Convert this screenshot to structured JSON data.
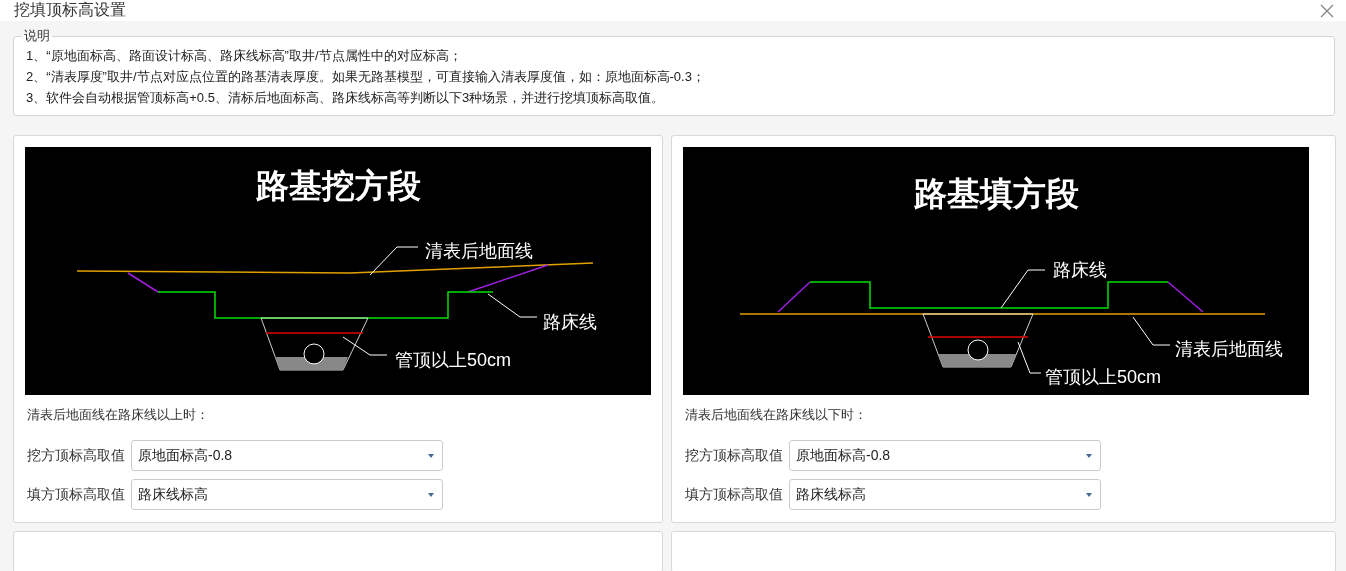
{
  "window": {
    "title": "挖填顶标高设置"
  },
  "notes": {
    "legend": "说明",
    "lines": [
      "1、“原地面标高、路面设计标高、路床线标高”取井/节点属性中的对应标高；",
      "2、“清表厚度”取井/节点对应点位置的路基清表厚度。如果无路基模型，可直接输入清表厚度值，如：原地面标高-0.3；",
      "3、软件会自动根据管顶标高+0.5、清标后地面标高、路床线标高等判断以下3种场景，并进行挖填顶标高取值。"
    ]
  },
  "cards": [
    {
      "diagram": {
        "kind": "cut",
        "title": "路基挖方段",
        "labels": [
          "清表后地面线",
          "路床线",
          "管顶以上50cm"
        ]
      },
      "caption": "清表后地面线在路床线以上时：",
      "fields": [
        {
          "label": "挖方顶标高取值",
          "value": "原地面标高-0.8"
        },
        {
          "label": "填方顶标高取值",
          "value": "路床线标高"
        }
      ]
    },
    {
      "diagram": {
        "kind": "fill",
        "title": "路基填方段",
        "labels": [
          "路床线",
          "清表后地面线",
          "管顶以上50cm"
        ]
      },
      "caption": "清表后地面线在路床线以下时：",
      "fields": [
        {
          "label": "挖方顶标高取值",
          "value": "原地面标高-0.8"
        },
        {
          "label": "填方顶标高取值",
          "value": "路床线标高"
        }
      ]
    }
  ]
}
